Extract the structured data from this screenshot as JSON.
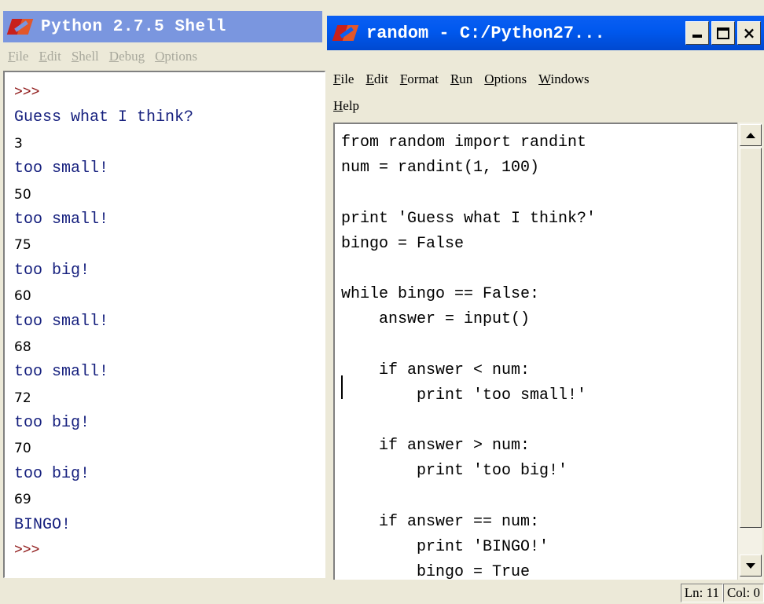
{
  "shell": {
    "title": "Python 2.7.5 Shell",
    "menu": [
      "File",
      "Edit",
      "Shell",
      "Debug",
      "Options"
    ],
    "lines": [
      {
        "text": ">>>",
        "kind": "prompt"
      },
      {
        "text": "Guess what I think?",
        "kind": "out"
      },
      {
        "text": "3",
        "kind": "in"
      },
      {
        "text": "too small!",
        "kind": "out"
      },
      {
        "text": "50",
        "kind": "in"
      },
      {
        "text": "too small!",
        "kind": "out"
      },
      {
        "text": "75",
        "kind": "in"
      },
      {
        "text": "too big!",
        "kind": "out"
      },
      {
        "text": "60",
        "kind": "in"
      },
      {
        "text": "too small!",
        "kind": "out"
      },
      {
        "text": "68",
        "kind": "in"
      },
      {
        "text": "too small!",
        "kind": "out"
      },
      {
        "text": "72",
        "kind": "in"
      },
      {
        "text": "too big!",
        "kind": "out"
      },
      {
        "text": "70",
        "kind": "in"
      },
      {
        "text": "too big!",
        "kind": "out"
      },
      {
        "text": "69",
        "kind": "in"
      },
      {
        "text": "BINGO!",
        "kind": "out"
      },
      {
        "text": ">>>",
        "kind": "prompt"
      }
    ]
  },
  "editor": {
    "title": "random - C:/Python27...",
    "buttons": {
      "minimize_icon": "minimize-icon",
      "maximize_icon": "maximize-icon",
      "close": "×"
    },
    "menu_row1": [
      "File",
      "Edit",
      "Format",
      "Run",
      "Options",
      "Windows"
    ],
    "menu_row2": [
      "Help"
    ],
    "code": [
      "from random import randint",
      "num = randint(1, 100)",
      "",
      "print 'Guess what I think?'",
      "bingo = False",
      "",
      "while bingo == False:",
      "    answer = input()",
      "",
      "    if answer < num:",
      "        print 'too small!'",
      "",
      "    if answer > num:",
      "        print 'too big!'",
      "",
      "    if answer == num:",
      "        print 'BINGO!'",
      "        bingo = True"
    ],
    "status": {
      "ln": "Ln: 11",
      "col": "Col: 0"
    }
  }
}
